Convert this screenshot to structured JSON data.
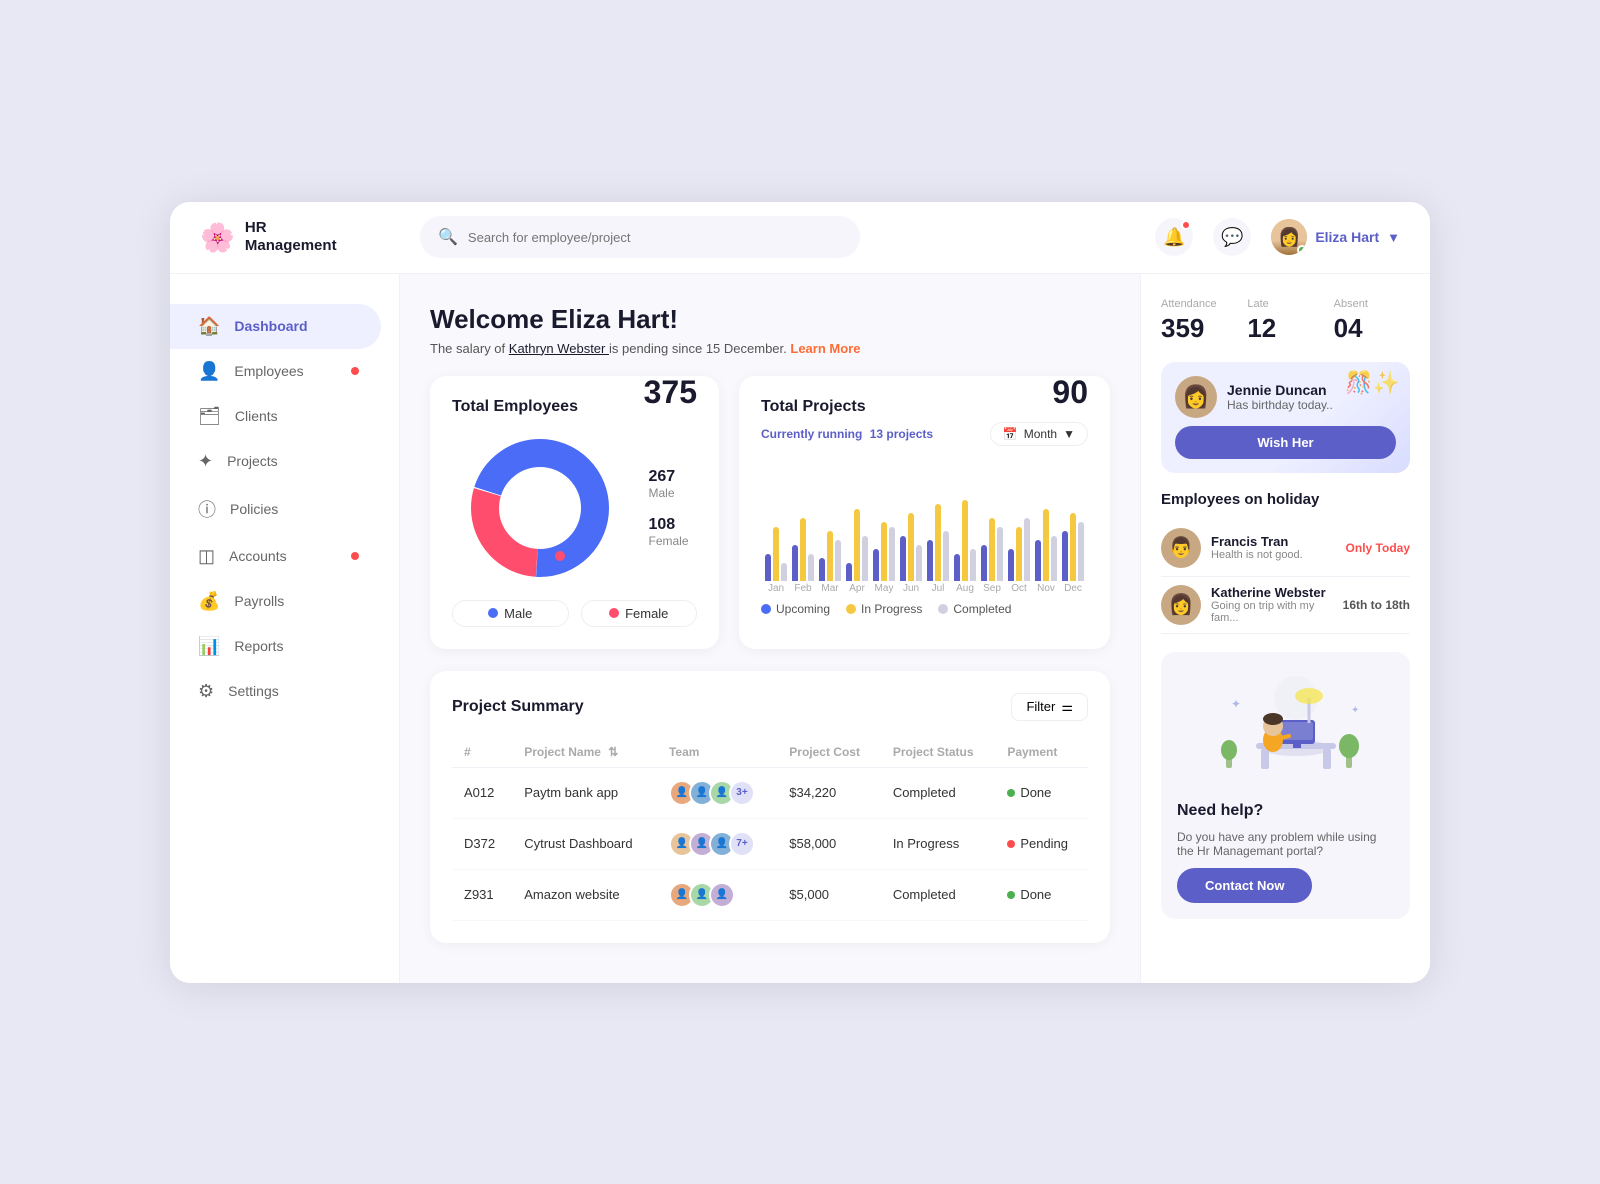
{
  "app": {
    "logo_text": "HR\nManagement",
    "logo_icon": "🌸"
  },
  "topbar": {
    "search_placeholder": "Search for employee/project",
    "user_name": "Eliza Hart"
  },
  "sidebar": {
    "items": [
      {
        "label": "Dashboard",
        "icon": "⌂",
        "active": true,
        "badge": false
      },
      {
        "label": "Employees",
        "icon": "👤",
        "active": false,
        "badge": true
      },
      {
        "label": "Clients",
        "icon": "🗂",
        "active": false,
        "badge": false
      },
      {
        "label": "Projects",
        "icon": "✦",
        "active": false,
        "badge": false
      },
      {
        "label": "Policies",
        "icon": "ⓘ",
        "active": false,
        "badge": false
      },
      {
        "label": "Accounts",
        "icon": "◫",
        "active": false,
        "badge": true
      },
      {
        "label": "Payrolls",
        "icon": "💰",
        "active": false,
        "badge": false
      },
      {
        "label": "Reports",
        "icon": "📊",
        "active": false,
        "badge": false
      },
      {
        "label": "Settings",
        "icon": "⚙",
        "active": false,
        "badge": false
      }
    ]
  },
  "welcome": {
    "title": "Welcome Eliza Hart!",
    "subtitle": "The salary of",
    "name_link": "Kathryn Webster",
    "suffix": "is pending since 15 December.",
    "learn_more": "Learn More"
  },
  "stats": {
    "attendance_label": "Attendance",
    "attendance_val": "359",
    "late_label": "Late",
    "late_val": "12",
    "absent_label": "Absent",
    "absent_val": "04"
  },
  "employee_card": {
    "title": "Total Employees",
    "total": "375",
    "male_count": "267",
    "male_label": "Male",
    "female_count": "108",
    "female_label": "Female",
    "male_legend": "Male",
    "female_legend": "Female"
  },
  "project_card": {
    "title": "Total Projects",
    "total": "90",
    "running_label": "Currently running",
    "running_count": "13 projects",
    "month_btn": "Month",
    "months": [
      "Jan",
      "Feb",
      "Mar",
      "Apr",
      "May",
      "Jun",
      "Jul",
      "Aug",
      "Sep",
      "Oct",
      "Nov",
      "Dec"
    ],
    "legend_upcoming": "Upcoming",
    "legend_inprogress": "In Progress",
    "legend_completed": "Completed",
    "bars": [
      {
        "up": 30,
        "prog": 60,
        "comp": 20
      },
      {
        "up": 40,
        "prog": 70,
        "comp": 30
      },
      {
        "up": 25,
        "prog": 55,
        "comp": 45
      },
      {
        "up": 20,
        "prog": 80,
        "comp": 50
      },
      {
        "up": 35,
        "prog": 65,
        "comp": 60
      },
      {
        "up": 50,
        "prog": 75,
        "comp": 40
      },
      {
        "up": 45,
        "prog": 85,
        "comp": 55
      },
      {
        "up": 30,
        "prog": 90,
        "comp": 35
      },
      {
        "up": 40,
        "prog": 70,
        "comp": 60
      },
      {
        "up": 35,
        "prog": 60,
        "comp": 70
      },
      {
        "up": 45,
        "prog": 80,
        "comp": 50
      },
      {
        "up": 55,
        "prog": 75,
        "comp": 65
      }
    ]
  },
  "project_summary": {
    "title": "Project Summary",
    "filter_btn": "Filter",
    "cols": [
      "#",
      "Project Name",
      "Team",
      "Project Cost",
      "Project Status",
      "Payment"
    ],
    "rows": [
      {
        "id": "A012",
        "name": "Paytm bank app",
        "cost": "$34,220",
        "status": "Completed",
        "payment": "Done",
        "payment_color": "done"
      },
      {
        "id": "D372",
        "name": "Cytrust Dashboard",
        "cost": "$58,000",
        "status": "In Progress",
        "payment": "Pending",
        "payment_color": "pending"
      },
      {
        "id": "Z931",
        "name": "Amazon website",
        "cost": "$5,000",
        "status": "Completed",
        "payment": "Done",
        "payment_color": "done"
      }
    ]
  },
  "birthday": {
    "name": "Jennie Duncan",
    "subtitle": "Has birthday today..",
    "wish_btn": "Wish Her",
    "deco": "🎉"
  },
  "holiday": {
    "section_title": "Employees on holiday",
    "items": [
      {
        "name": "Francis Tran",
        "desc": "Health is not good.",
        "range": "Only Today",
        "range_type": "only_today"
      },
      {
        "name": "Katherine Webster",
        "desc": "Going on trip with my fam...",
        "range": "16th to 18th",
        "range_type": "date_range"
      }
    ]
  },
  "help": {
    "title": "Need help?",
    "subtitle": "Do you have any problem while using the Hr Managemant portal?",
    "contact_btn": "Contact Now"
  }
}
